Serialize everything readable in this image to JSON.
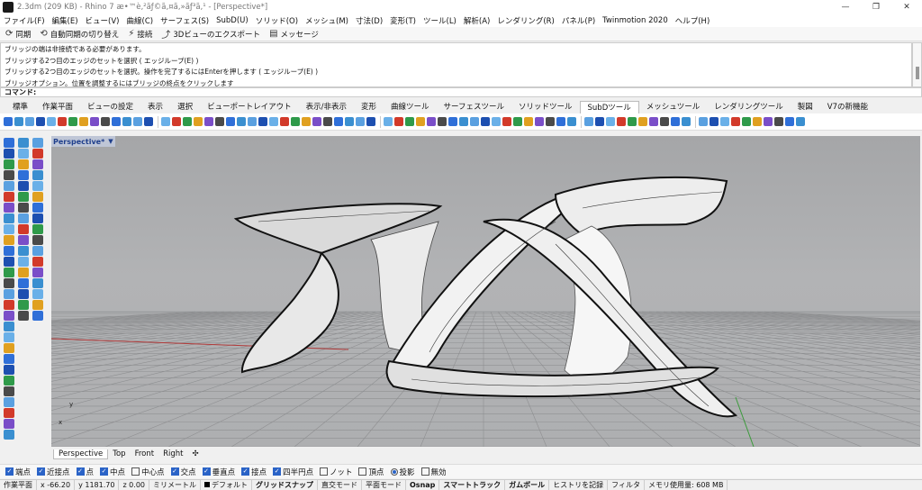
{
  "window": {
    "title": "2.3dm (209 KB) - Rhino 7 æ•™è‚²ãƒ©ã‚¤ã‚»ãƒ³ã‚¹ - [Perspective*]",
    "controls": [
      "—",
      "❐",
      "✕"
    ]
  },
  "menu": [
    "ファイル(F)",
    "編集(E)",
    "ビュー(V)",
    "曲線(C)",
    "サーフェス(S)",
    "SubD(U)",
    "ソリッド(O)",
    "メッシュ(M)",
    "寸法(D)",
    "変形(T)",
    "ツール(L)",
    "解析(A)",
    "レンダリング(R)",
    "パネル(P)",
    "Twinmotion 2020",
    "ヘルプ(H)"
  ],
  "syncbar": {
    "sync": "同期",
    "auto_sync": "自動同期の切り替え",
    "connect": "接続",
    "export_3d": "3Dビューのエクスポート",
    "message": "メッセージ"
  },
  "command_history": [
    "ブリッジの端は非接続である必要があります。",
    "ブリッジする2つ目のエッジのセットを選択 ( エッジループ(E) )",
    "ブリッジする2つ目のエッジのセットを選択。操作を完了するにはEnterを押します ( エッジループ(E) )",
    "ブリッジオプション。位置を調整するにはブリッジの終点をクリックします"
  ],
  "command_prompt": "コマンド:",
  "toolbar_tabs": [
    "標準",
    "作業平面",
    "ビューの設定",
    "表示",
    "選択",
    "ビューポートレイアウト",
    "表示/非表示",
    "変形",
    "曲線ツール",
    "サーフェスツール",
    "ソリッドツール",
    "SubDツール",
    "メッシュツール",
    "レンダリングツール",
    "製図",
    "V7の新機能"
  ],
  "active_toolbar_tab": "SubDツール",
  "viewport": {
    "label": "Perspective*",
    "axis_x": "x",
    "axis_y": "y"
  },
  "viewport_tabs": [
    "Perspective",
    "Top",
    "Front",
    "Right",
    "✣"
  ],
  "osnap": [
    {
      "label": "端点",
      "checked": true
    },
    {
      "label": "近接点",
      "checked": true
    },
    {
      "label": "点",
      "checked": true
    },
    {
      "label": "中点",
      "checked": true
    },
    {
      "label": "中心点",
      "checked": false
    },
    {
      "label": "交点",
      "checked": true
    },
    {
      "label": "垂直点",
      "checked": true
    },
    {
      "label": "接点",
      "checked": true
    },
    {
      "label": "四半円点",
      "checked": true
    },
    {
      "label": "ノット",
      "checked": false
    },
    {
      "label": "頂点",
      "checked": false
    },
    {
      "label": "投影",
      "checked": true,
      "radio": true
    },
    {
      "label": "無効",
      "checked": false
    }
  ],
  "status": {
    "plane": "作業平面",
    "x": "x -66.20",
    "y": "y 1181.70",
    "z": "z 0.00",
    "unit": "ミリメートル",
    "layer": "デフォルト",
    "grid_snap": "グリッドスナップ",
    "ortho": "直交モード",
    "planar": "平面モード",
    "osnap": "Osnap",
    "smart_track": "スマートトラック",
    "gumball": "ガムボール",
    "history": "ヒストリを記録",
    "filter": "フィルタ",
    "memory": "メモリ使用量: 608 MB"
  },
  "colors": {
    "accent": "#2a63c7",
    "viewport_top": "#a5a6a8",
    "grid_line": "#8e8f91",
    "x_axis": "#b13a3a",
    "y_axis": "#3a9a3a"
  }
}
